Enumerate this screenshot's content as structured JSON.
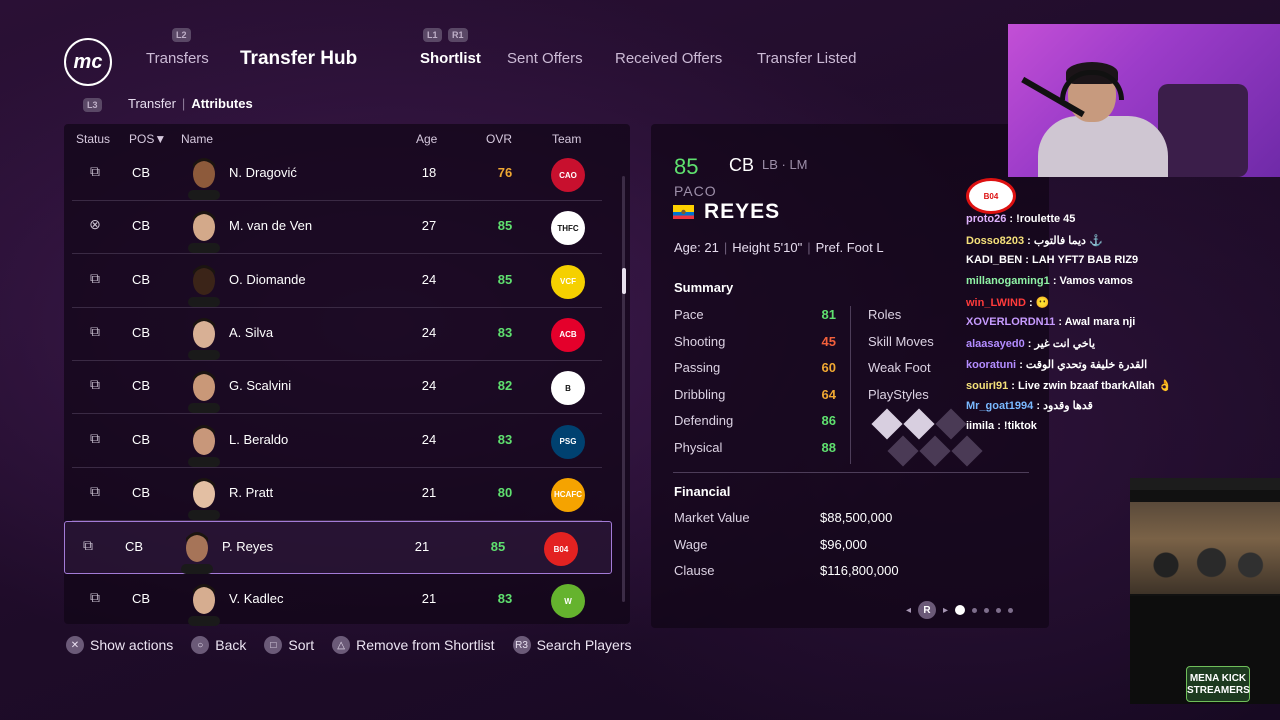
{
  "header": {
    "logo_text": "mc",
    "l2_hint": "L2",
    "l1_hint": "L1",
    "r1_hint": "R1",
    "l3_hint": "L3",
    "transfers_label": "Transfers",
    "hub_title": "Transfer Hub",
    "tabs": [
      "Shortlist",
      "Sent Offers",
      "Received Offers",
      "Transfer Listed"
    ],
    "active_tab": "Shortlist",
    "subnav": [
      "Transfer",
      "Attributes"
    ]
  },
  "table": {
    "headers": {
      "status": "Status",
      "pos": "POS",
      "name": "Name",
      "age": "Age",
      "ovr": "OVR",
      "team": "Team"
    },
    "rows": [
      {
        "status": "binoculars-icon",
        "pos": "CB",
        "name": "N. Dragović",
        "age": "18",
        "ovr": "76",
        "ovr_color": "#f0a832",
        "crest_color": "#c8102e",
        "crest_text": "CAO",
        "skin": "#8d5a3b"
      },
      {
        "status": "close-circle-icon",
        "pos": "CB",
        "name": "M. van de Ven",
        "age": "27",
        "ovr": "85",
        "ovr_color": "#5fe06f",
        "crest_color": "#ffffff",
        "crest_text": "THFC",
        "skin": "#d3a98a"
      },
      {
        "status": "binoculars-icon",
        "pos": "CB",
        "name": "O. Diomande",
        "age": "24",
        "ovr": "85",
        "ovr_color": "#5fe06f",
        "crest_color": "#f5d000",
        "crest_text": "VCF",
        "skin": "#3b2418"
      },
      {
        "status": "binoculars-icon",
        "pos": "CB",
        "name": "A. Silva",
        "age": "24",
        "ovr": "83",
        "ovr_color": "#5fe06f",
        "crest_color": "#e4002b",
        "crest_text": "ACB",
        "skin": "#d8b095"
      },
      {
        "status": "binoculars-icon",
        "pos": "CB",
        "name": "G. Scalvini",
        "age": "24",
        "ovr": "82",
        "ovr_color": "#5fe06f",
        "crest_color": "#ffffff",
        "crest_text": "B",
        "skin": "#c99878"
      },
      {
        "status": "binoculars-icon",
        "pos": "CB",
        "name": "L. Beraldo",
        "age": "24",
        "ovr": "83",
        "ovr_color": "#5fe06f",
        "crest_color": "#004170",
        "crest_text": "PSG",
        "skin": "#c8977a"
      },
      {
        "status": "binoculars-icon",
        "pos": "CB",
        "name": "R. Pratt",
        "age": "21",
        "ovr": "80",
        "ovr_color": "#5fe06f",
        "crest_color": "#f5a300",
        "crest_text": "HCAFC",
        "skin": "#e3bfa3"
      },
      {
        "status": "binoculars-icon",
        "pos": "CB",
        "name": "P. Reyes",
        "age": "21",
        "ovr": "85",
        "ovr_color": "#5fe06f",
        "crest_color": "#e32221",
        "crest_text": "B04",
        "skin": "#a67458"
      },
      {
        "status": "binoculars-icon",
        "pos": "CB",
        "name": "V. Kadlec",
        "age": "21",
        "ovr": "83",
        "ovr_color": "#5fe06f",
        "crest_color": "#65b32e",
        "crest_text": "W",
        "skin": "#d6ad90"
      }
    ],
    "selected_index": 7
  },
  "detail": {
    "ovr": "85",
    "ovr_color": "#5fe06f",
    "position": "CB",
    "alt_positions": "LB · LM",
    "first_name": "PACO",
    "last_name": "REYES",
    "age_label": "Age:",
    "age": "21",
    "height_label": "Height",
    "height": "5'10\"",
    "foot_label": "Pref. Foot",
    "foot": "L",
    "summary_title": "Summary",
    "stats": [
      {
        "label": "Pace",
        "value": "81",
        "color": "#5fe06f"
      },
      {
        "label": "Shooting",
        "value": "45",
        "color": "#f2603c"
      },
      {
        "label": "Passing",
        "value": "60",
        "color": "#f0a832"
      },
      {
        "label": "Dribbling",
        "value": "64",
        "color": "#f0a832"
      },
      {
        "label": "Defending",
        "value": "86",
        "color": "#5fe06f"
      },
      {
        "label": "Physical",
        "value": "88",
        "color": "#5fe06f"
      }
    ],
    "right_labels": [
      "Roles",
      "Skill Moves",
      "Weak Foot",
      "PlayStyles"
    ],
    "financial_title": "Financial",
    "financial": [
      {
        "label": "Market Value",
        "value": "$88,500,000"
      },
      {
        "label": "Wage",
        "value": "$96,000"
      },
      {
        "label": "Clause",
        "value": "$116,800,000"
      }
    ],
    "pager_button": "R"
  },
  "footer": {
    "hints": [
      {
        "icon": "cross-button-icon",
        "glyph": "✕",
        "label": "Show actions"
      },
      {
        "icon": "circle-button-icon",
        "glyph": "○",
        "label": "Back"
      },
      {
        "icon": "square-button-icon",
        "glyph": "□",
        "label": "Sort"
      },
      {
        "icon": "triangle-button-icon",
        "glyph": "△",
        "label": "Remove from Shortlist"
      },
      {
        "icon": "r3-button-icon",
        "glyph": "R3",
        "label": "Search Players"
      }
    ]
  },
  "chat": {
    "messages": [
      {
        "user": "proto26",
        "color": "#e0b4ff",
        "text": ": !roulette 45"
      },
      {
        "user": "Dosso8203",
        "color": "#f5e17a",
        "text": ": ديما فالتوب ⚓"
      },
      {
        "user": "KADI_BEN",
        "color": "#ffffff",
        "text": ": LAH YFT7 BAB RIZ9"
      },
      {
        "user": "millanogaming1",
        "color": "#8ff2a5",
        "text": ": Vamos vamos"
      },
      {
        "user": "win_LWIND",
        "color": "#ff3b3b",
        "text": ": 😶"
      },
      {
        "user": "XOVERLORDN11",
        "color": "#c79bff",
        "text": ": Awal mara nji"
      },
      {
        "user": "alaasayed0",
        "color": "#b38cff",
        "text": ": ياخي انت غير"
      },
      {
        "user": "kooratuni",
        "color": "#b38cff",
        "text": ": القدرة خليفة وتحدي الوقت"
      },
      {
        "user": "souirI91",
        "color": "#f5e17a",
        "text": ": Live zwin bzaaf tbarkAllah 👌"
      },
      {
        "user": "Mr_goat1994",
        "color": "#7ab8ff",
        "text": ": قدها وقدود"
      },
      {
        "user": "iimila",
        "color": "#ffffff",
        "text": ": !tiktok"
      }
    ]
  },
  "minicam": {
    "badge_text": "MENA KICK STREAMERS"
  }
}
